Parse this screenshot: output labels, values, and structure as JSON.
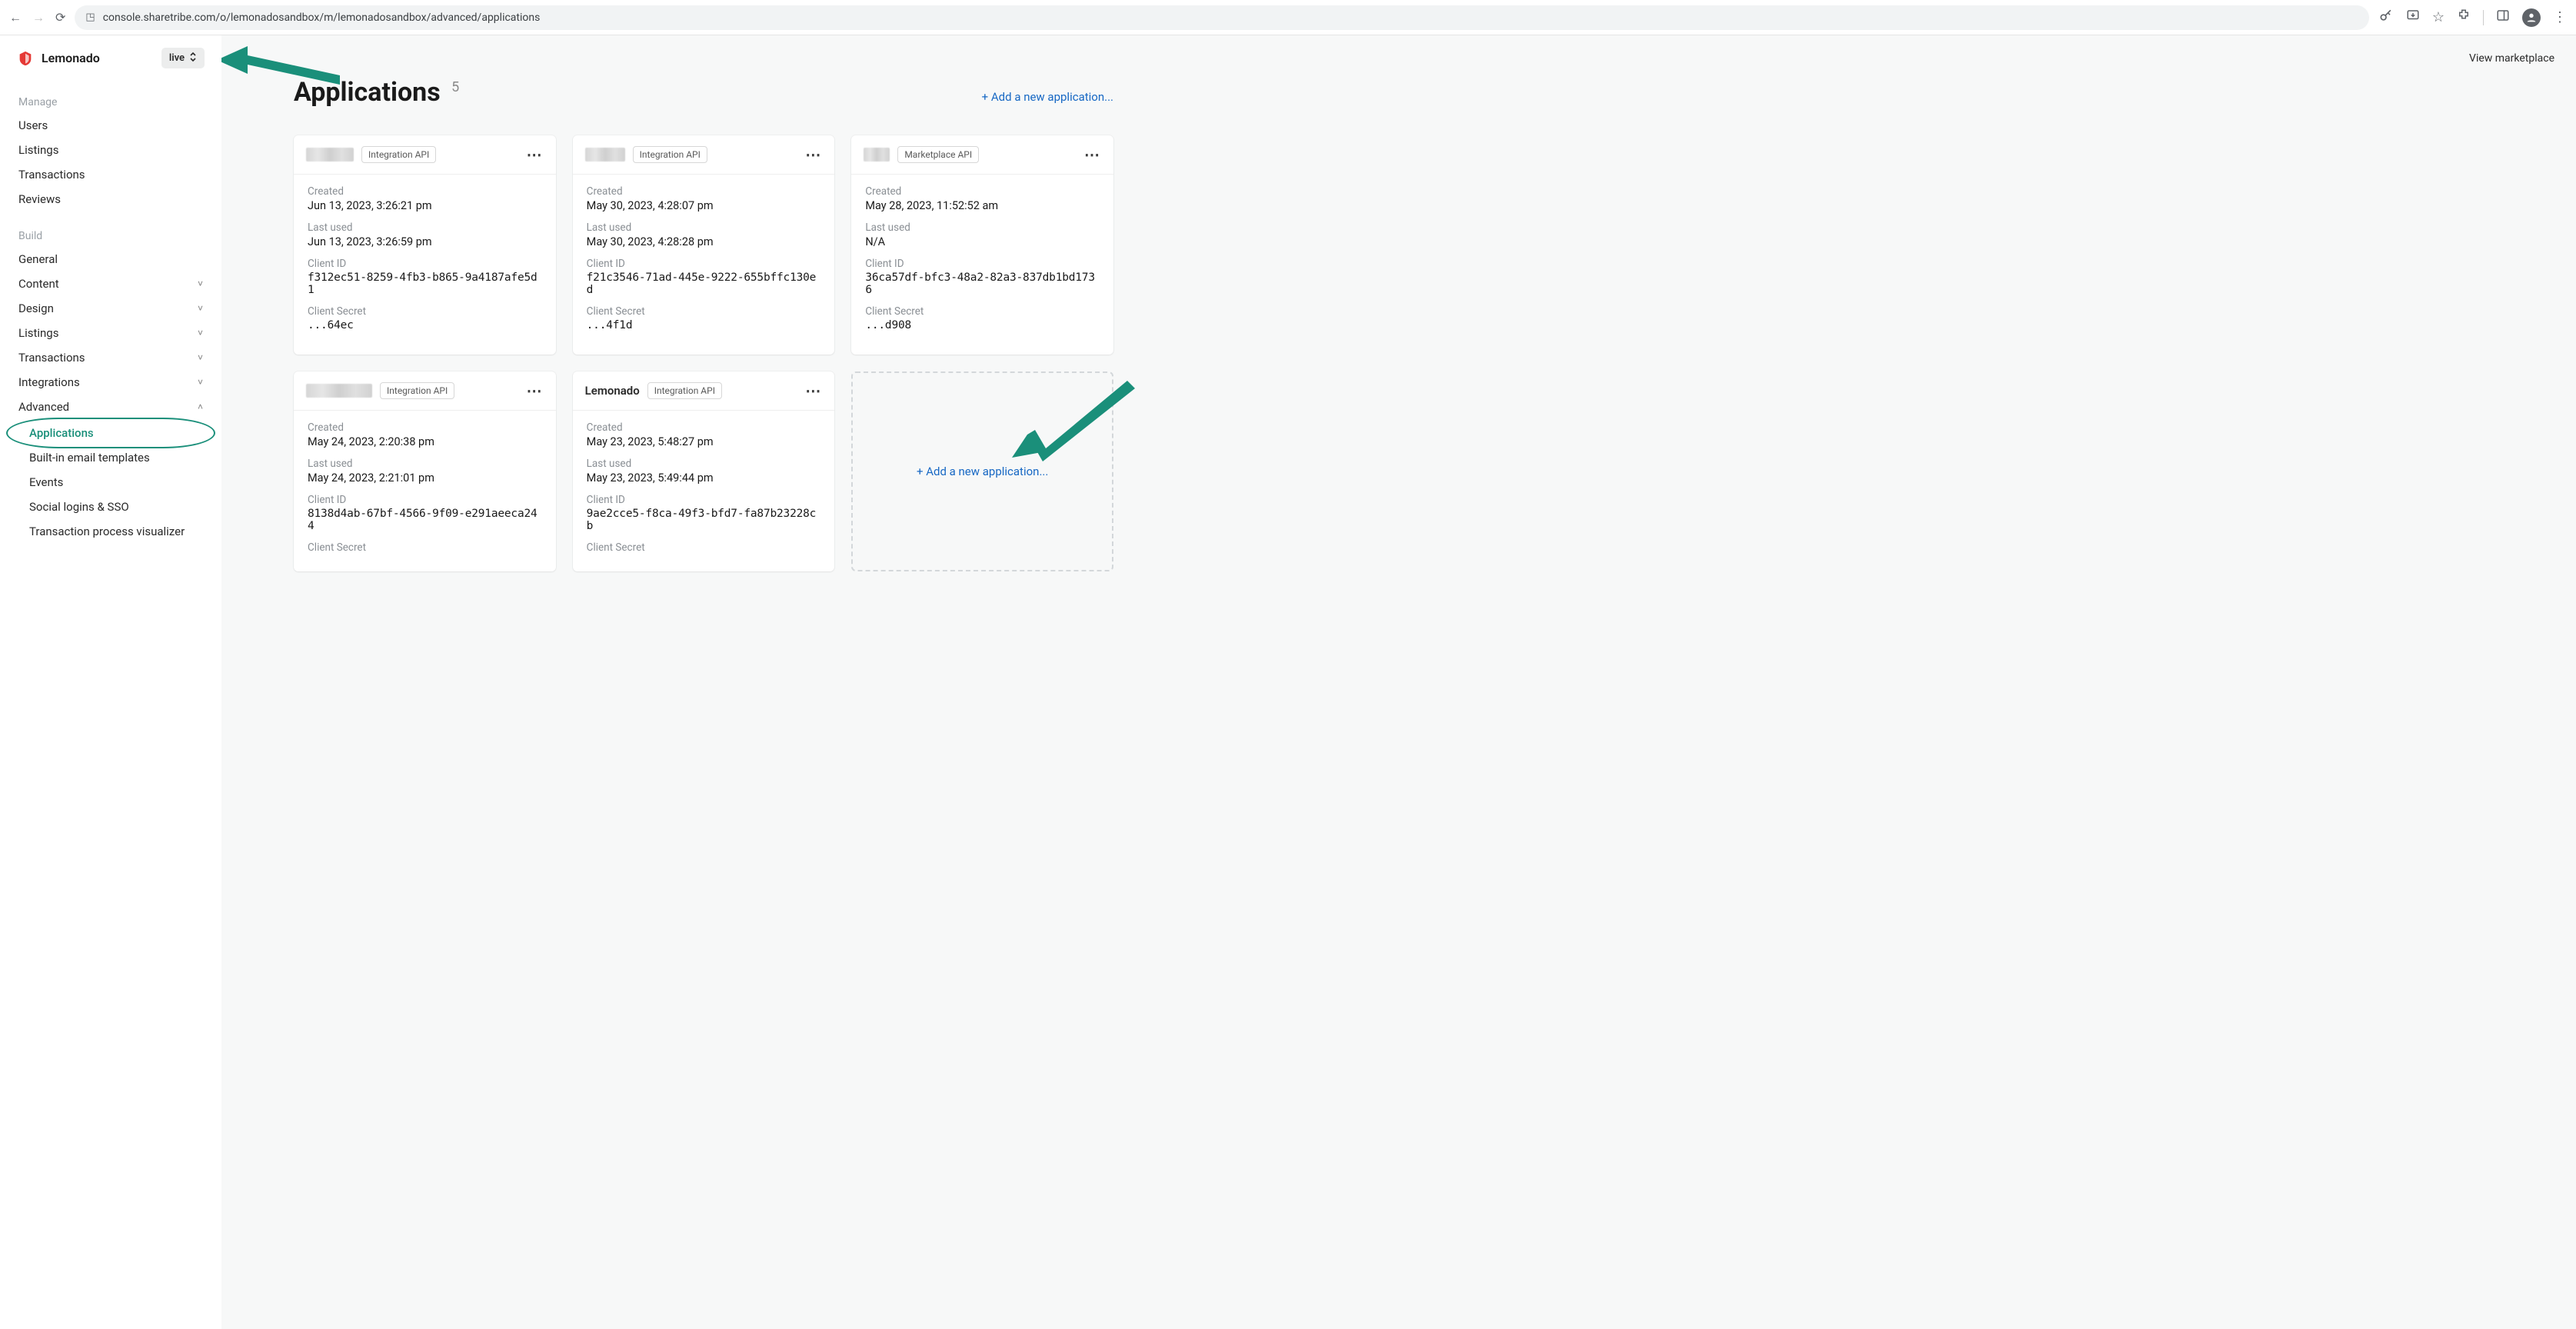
{
  "browser": {
    "url": "console.sharetribe.com/o/lemonadosandbox/m/lemonadosandbox/advanced/applications"
  },
  "brand": {
    "name": "Lemonado"
  },
  "env_selector": {
    "label": "live"
  },
  "top_nav": {
    "view_marketplace": "View marketplace"
  },
  "sidebar": {
    "manage": {
      "title": "Manage",
      "items": [
        "Users",
        "Listings",
        "Transactions",
        "Reviews"
      ]
    },
    "build": {
      "title": "Build",
      "items": [
        {
          "label": "General",
          "expandable": false
        },
        {
          "label": "Content",
          "expandable": true
        },
        {
          "label": "Design",
          "expandable": true
        },
        {
          "label": "Listings",
          "expandable": true
        },
        {
          "label": "Transactions",
          "expandable": true
        },
        {
          "label": "Integrations",
          "expandable": true
        },
        {
          "label": "Advanced",
          "expandable": true,
          "open": true
        }
      ],
      "advanced_sub": [
        "Applications",
        "Built-in email templates",
        "Events",
        "Social logins & SSO",
        "Transaction process visualizer"
      ]
    }
  },
  "page": {
    "title": "Applications",
    "count": "5",
    "add_label": "+ Add a new application...",
    "add_label_card": "+ Add a new application..."
  },
  "labels": {
    "created": "Created",
    "last_used": "Last used",
    "client_id": "Client ID",
    "client_secret": "Client Secret"
  },
  "apps": [
    {
      "name_blurred": true,
      "name": "",
      "api": "Integration API",
      "created": "Jun 13, 2023, 3:26:21 pm",
      "last_used": "Jun 13, 2023, 3:26:59 pm",
      "client_id": "f312ec51-8259-4fb3-b865-9a4187afe5d1",
      "client_secret": "...64ec"
    },
    {
      "name_blurred": true,
      "name": "",
      "api": "Integration API",
      "created": "May 30, 2023, 4:28:07 pm",
      "last_used": "May 30, 2023, 4:28:28 pm",
      "client_id": "f21c3546-71ad-445e-9222-655bffc130ed",
      "client_secret": "...4f1d"
    },
    {
      "name_blurred": true,
      "name": "",
      "api": "Marketplace API",
      "created": "May 28, 2023, 11:52:52 am",
      "last_used": "N/A",
      "client_id": "36ca57df-bfc3-48a2-82a3-837db1bd1736",
      "client_secret": "...d908"
    },
    {
      "name_blurred": true,
      "name": "",
      "api": "Integration API",
      "created": "May 24, 2023, 2:20:38 pm",
      "last_used": "May 24, 2023, 2:21:01 pm",
      "client_id": "8138d4ab-67bf-4566-9f09-e291aeeca244",
      "client_secret": ""
    },
    {
      "name_blurred": false,
      "name": "Lemonado",
      "api": "Integration API",
      "created": "May 23, 2023, 5:48:27 pm",
      "last_used": "May 23, 2023, 5:49:44 pm",
      "client_id": "9ae2cce5-f8ca-49f3-bfd7-fa87b23228cb",
      "client_secret": ""
    }
  ],
  "colors": {
    "accent": "#1a8f7a",
    "link": "#1768c4"
  }
}
